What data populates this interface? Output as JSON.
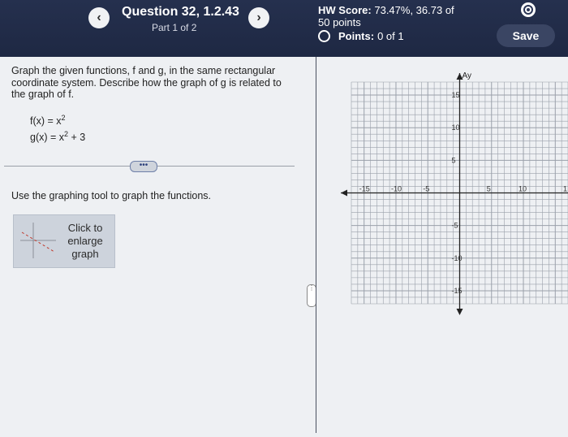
{
  "header": {
    "prev_label": "‹",
    "next_label": "›",
    "question_title": "Question 32, 1.2.43",
    "part_label": "Part 1 of 2",
    "hw_score_label": "HW Score:",
    "hw_score_value": "73.47%, 36.73 of",
    "hw_points": "50 points",
    "points_label": "Points:",
    "points_value": "0 of 1",
    "save_label": "Save"
  },
  "problem": {
    "prompt": "Graph the given functions, f and g, in the same rectangular coordinate system. Describe how the graph of g is related to the graph of f.",
    "f_base": "f(x) = x",
    "f_exp": "2",
    "g_base": "g(x) = x",
    "g_exp": "2",
    "g_tail": " + 3",
    "more_label": "•••",
    "instruction": "Use the graphing tool to graph the functions.",
    "enlarge_label": "Click to enlarge graph"
  },
  "graph": {
    "y_axis_label": "Ay",
    "y_ticks": [
      "15",
      "10",
      "5",
      "-5",
      "-10",
      "-15"
    ],
    "x_ticks": [
      "-15",
      "-10",
      "-5",
      "5",
      "10"
    ],
    "x_range": [
      -17,
      17
    ],
    "y_range": [
      -17,
      17
    ],
    "edge_label": "1"
  },
  "colors": {
    "header_bg": "#25304e",
    "save_bg": "#3a4563",
    "grid_line": "#8a8f99"
  }
}
